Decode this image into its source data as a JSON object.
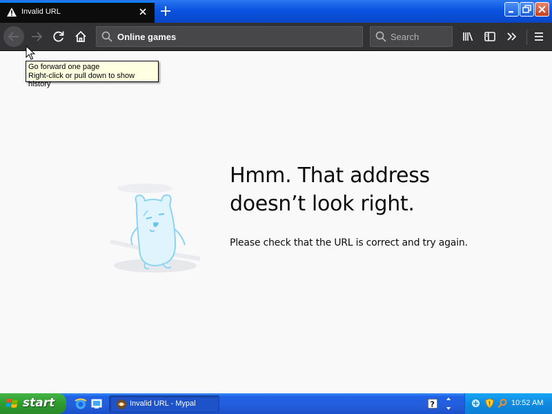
{
  "browser": {
    "tab": {
      "title": "Invalid URL",
      "close_icon": "close-icon",
      "status_icon": "warning-icon"
    },
    "new_tab_icon": "plus-icon",
    "window_controls": [
      "minimize",
      "restore",
      "close"
    ],
    "nav": {
      "back_icon": "arrow-left-icon",
      "forward_icon": "arrow-right-icon",
      "reload_icon": "reload-icon",
      "home_icon": "home-icon"
    },
    "url_bar": {
      "value": "Online games"
    },
    "search": {
      "placeholder": "Search"
    },
    "toolbar_icons": [
      "library-icon",
      "sidebar-icon",
      "overflow-icon",
      "menu-icon"
    ]
  },
  "tooltip": {
    "line1": "Go forward one page",
    "line2": "Right-click or pull down to show history"
  },
  "error": {
    "title_line1": "Hmm. That address",
    "title_line2": "doesn’t look right.",
    "description": "Please check that the URL is correct and try again."
  },
  "taskbar": {
    "start_label": "start",
    "task_label": "Invalid URL - Mypal",
    "clock": "10:52 AM"
  },
  "colors": {
    "tab_bg": "#0c0c0d",
    "navbar_bg": "#323234",
    "page_bg": "#f9f9fa",
    "taskbar_blue": "#245edb",
    "start_green": "#2e9b2e",
    "tooltip_bg": "#ffffe1"
  }
}
